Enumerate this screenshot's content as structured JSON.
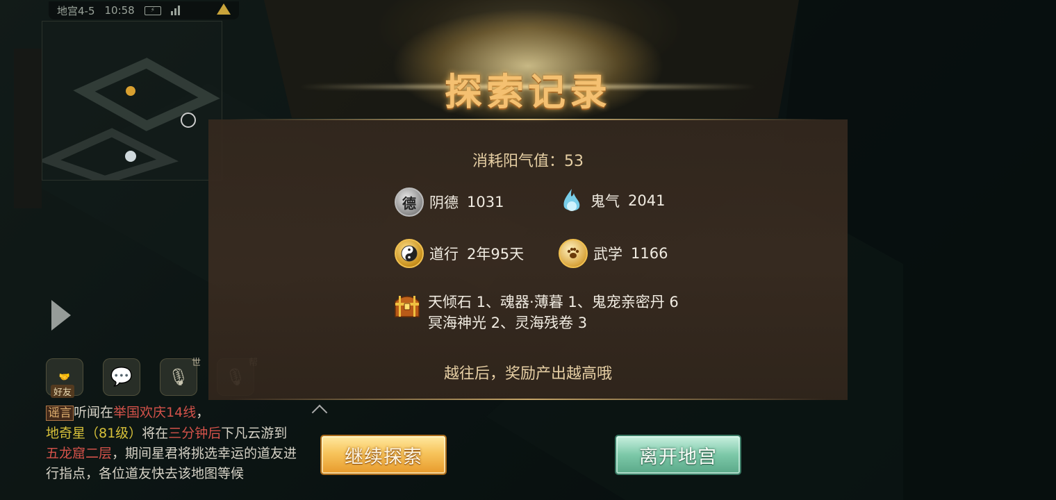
{
  "status_bar": {
    "location": "地宫4-5",
    "time": "10:58"
  },
  "dialog": {
    "title": "探索记录",
    "cost_text": "消耗阳气值：53",
    "stats": [
      {
        "icon": "yinde-badge-icon",
        "icon_glyph": "德",
        "name": "阴德",
        "value": "1031"
      },
      {
        "icon": "ghost-flame-icon",
        "name": "鬼气",
        "value": "2041"
      },
      {
        "icon": "yin-yang-icon",
        "name": "道行",
        "value": "2年95天"
      },
      {
        "icon": "paw-badge-icon",
        "name": "武学",
        "value": "1166"
      }
    ],
    "items_icon": "treasure-chest-icon",
    "items_line1": "天倾石 1、魂器·薄暮 1、鬼宠亲密丹 6",
    "items_line2": "冥海神光 2、灵海残卷 3",
    "hint": "越往后，奖励产出越高哦",
    "continue_label": "继续探索",
    "leave_label": "离开地宫"
  },
  "chat": {
    "friend_label": "好友",
    "world_tag": "世",
    "gang_tag": "帮",
    "rumor_tag": "谣言",
    "msg_1": "听闻在",
    "msg_line": "举国欢庆14线",
    "msg_2": "，",
    "msg_star": "地奇星（81级）",
    "msg_3": "将在",
    "msg_time": "三分钟后",
    "msg_4": "下凡云游到",
    "msg_place": "五龙窟二层",
    "msg_5": "，期间星君将挑选幸运的道友进行指点，各位道友快去该地图等候"
  },
  "colors": {
    "title": "#f4c071",
    "continue_button": "#f7c45c",
    "leave_button": "#7cc8a8",
    "chat_red": "#d4524a",
    "chat_yellow": "#d8c23a"
  }
}
